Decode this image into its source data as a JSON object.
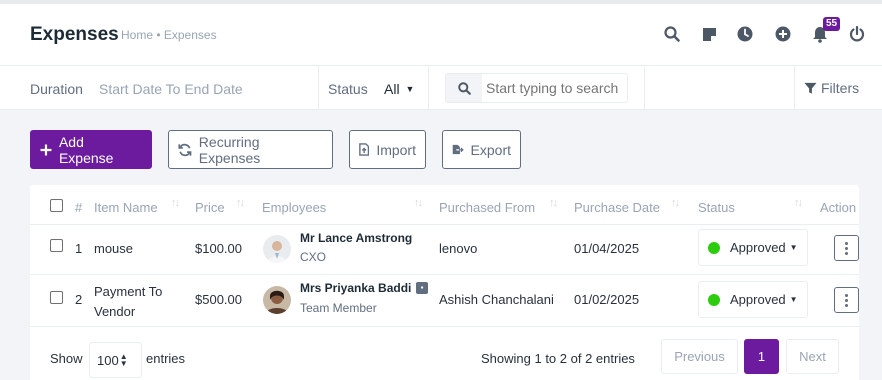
{
  "header": {
    "title": "Expenses",
    "breadcrumb": "Home • Expenses",
    "notification_count": "55",
    "icons": [
      "search-icon",
      "sticky-note-icon",
      "clock-icon",
      "plus-circle-icon",
      "bell-icon",
      "power-icon"
    ]
  },
  "filters": {
    "duration_label": "Duration",
    "duration_value": "Start Date To End Date",
    "status_label": "Status",
    "status_value": "All",
    "search_placeholder": "Start typing to search",
    "filters_label": "Filters"
  },
  "actions": {
    "add": "Add Expense",
    "recurring": "Recurring Expenses",
    "import": "Import",
    "export": "Export"
  },
  "table": {
    "columns": [
      "#",
      "Item Name",
      "Price",
      "Employees",
      "Purchased From",
      "Purchase Date",
      "Status",
      "Action"
    ],
    "rows": [
      {
        "num": "1",
        "item": "mouse",
        "price": "$100.00",
        "employee_name": "Mr Lance Amstrong",
        "employee_role": "CXO",
        "purchased_from": "lenovo",
        "date": "01/04/2025",
        "status": "Approved"
      },
      {
        "num": "2",
        "item": "Payment To Vendor",
        "price": "$500.00",
        "employee_name": "Mrs Priyanka Baddi",
        "employee_role": "Team Member",
        "purchased_from": "Ashish Chanchalani",
        "date": "01/02/2025",
        "status": "Approved"
      }
    ]
  },
  "footer": {
    "show": "Show",
    "length": "100",
    "entries": "entries",
    "info": "Showing 1 to 2 of 2 entries",
    "previous": "Previous",
    "page": "1",
    "next": "Next"
  },
  "colors": {
    "accent": "#6c1b9e",
    "approved": "#2ecc0e"
  }
}
